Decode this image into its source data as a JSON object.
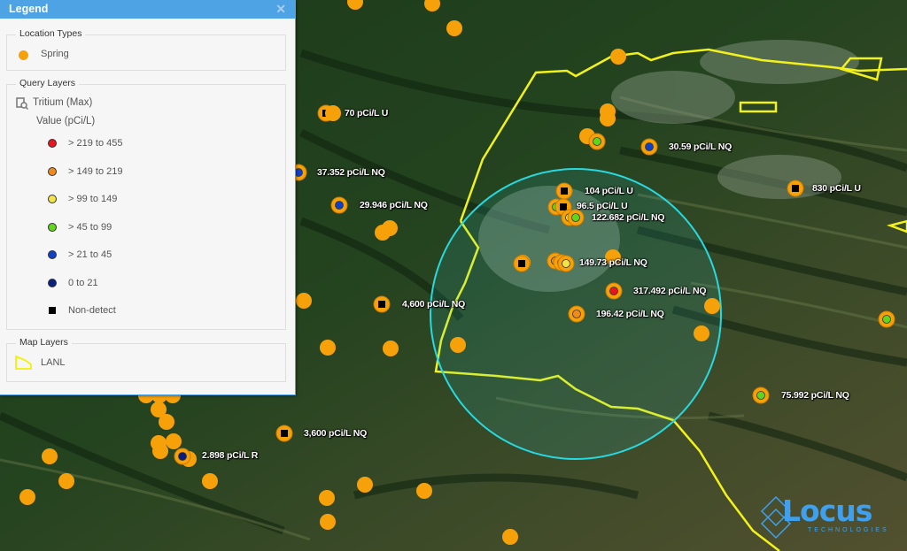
{
  "legend": {
    "title": "Legend",
    "close_icon": "close-icon",
    "location_types": {
      "title": "Location Types",
      "items": [
        {
          "label": "Spring",
          "color": "#f7a10a"
        }
      ]
    },
    "query_layers": {
      "title": "Query Layers",
      "layer_name": "Tritium (Max)",
      "layer_icon": "query-layer-icon",
      "value_label": "Value (pCi/L)",
      "classes": [
        {
          "label": "> 219 to 455",
          "color": "#e8141e"
        },
        {
          "label": "> 149 to 219",
          "color": "#f08a1c"
        },
        {
          "label": "> 99 to 149",
          "color": "#f2e444"
        },
        {
          "label": "> 45 to 99",
          "color": "#5ed61a"
        },
        {
          "label": "> 21 to 45",
          "color": "#1040c8"
        },
        {
          "label": "0 to 21",
          "color": "#0a1e80"
        },
        {
          "label": "Non-detect",
          "color": "#000000",
          "shape": "square"
        }
      ]
    },
    "map_layers": {
      "title": "Map Layers",
      "items": [
        {
          "label": "LANL",
          "color": "#ffff00",
          "shape": "polygon"
        }
      ]
    }
  },
  "map": {
    "buffer_circle_color": "#27d9e0",
    "boundary_color": "#f2f21a",
    "spring_color": "#f7a10a",
    "labels": [
      {
        "text": "70 pCi/L U"
      },
      {
        "text": "37.352 pCi/L NQ"
      },
      {
        "text": "29.946 pCi/L NQ"
      },
      {
        "text": "30.59 pCi/L NQ"
      },
      {
        "text": "830 pCi/L U"
      },
      {
        "text": "104 pCi/L U"
      },
      {
        "text": "96.5 pCi/L U"
      },
      {
        "text": "122.682 pCi/L NQ"
      },
      {
        "text": "149.73 pCi/L NQ"
      },
      {
        "text": "317.492 pCi/L NQ"
      },
      {
        "text": "196.42 pCi/L NQ"
      },
      {
        "text": "4,600 pCi/L NQ"
      },
      {
        "text": "3,600 pCi/L NQ"
      },
      {
        "text": "2.898 pCi/L R"
      },
      {
        "text": "75.992 pCi/L NQ"
      }
    ]
  },
  "branding": {
    "logo_text": "Locus",
    "logo_subtext": "TECHNOLOGIES"
  }
}
